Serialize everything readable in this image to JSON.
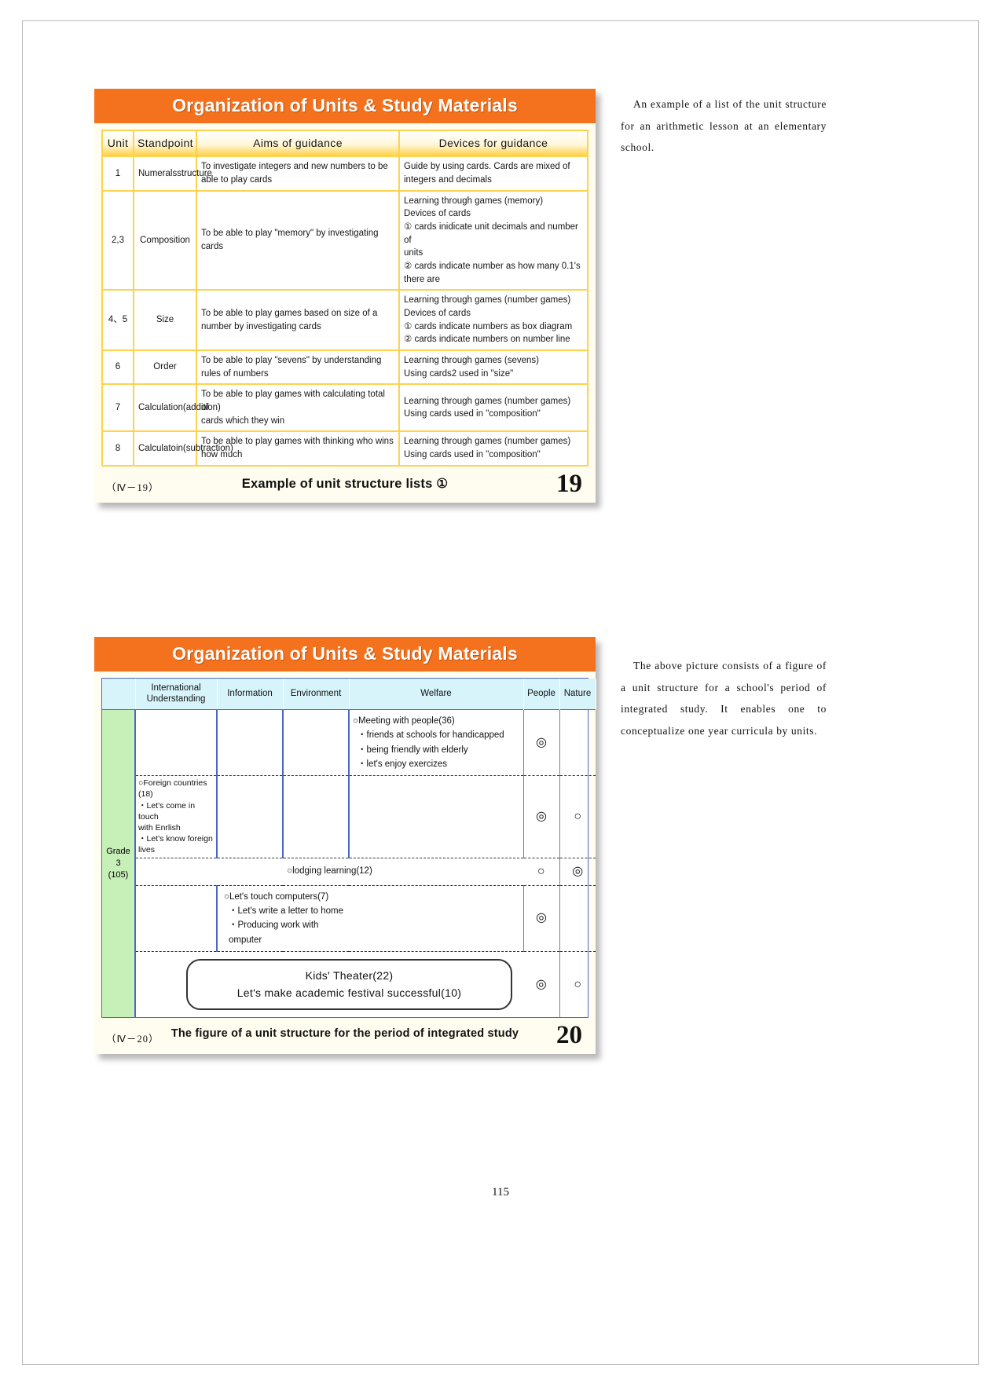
{
  "page": {
    "number": "115"
  },
  "slide1": {
    "title": "Organization of Units & Study Materials",
    "table": {
      "headers": [
        "Unit",
        "Standpoint",
        "Aims of guidance",
        "Devices for guidance"
      ],
      "rows": [
        {
          "unit": "1",
          "standpoint": [
            "Numerals",
            "structure"
          ],
          "aims": [
            "To investigate integers and new numbers to be",
            "able to play cards"
          ],
          "devices": [
            "Guide by using cards.  Cards are mixed of",
            "integers and decimals"
          ]
        },
        {
          "unit": "2,3",
          "standpoint": [
            "Composition"
          ],
          "aims": [
            "To be able to play \"memory\" by investigating",
            "cards"
          ],
          "devices": [
            "Learning through games (memory)",
            "Devices of cards",
            "① cards inidicate unit decimals and number of",
            "units",
            "② cards indicate number as how many 0.1's",
            "there are"
          ]
        },
        {
          "unit": "4、5",
          "standpoint": [
            "Size"
          ],
          "aims": [
            "To be able to play games based on size of a",
            "number by investigating cards"
          ],
          "devices": [
            "Learning through games (number games)",
            "Devices of cards",
            "① cards indicate numbers as box diagram",
            "② cards indicate numbers on number line"
          ]
        },
        {
          "unit": "6",
          "standpoint": [
            "Order"
          ],
          "aims": [
            "To be able to play \"sevens\" by understanding",
            "rules of numbers"
          ],
          "devices": [
            "Learning through games (sevens)",
            "Using cards2 used in \"size\""
          ]
        },
        {
          "unit": "7",
          "standpoint": [
            "Calculation",
            "(addition)"
          ],
          "aims": [
            "To be able to play games with calculating total of",
            "cards which they win"
          ],
          "devices": [
            "Learning through games (number games)",
            "Using cards used in \"composition\""
          ]
        },
        {
          "unit": "8",
          "standpoint": [
            "Calculatoin",
            "(subtraction)"
          ],
          "aims": [
            "To be able to play games with thinking who wins",
            "how much"
          ],
          "devices": [
            "Learning through games (number games)",
            "Using cards used in \"composition\""
          ]
        }
      ]
    },
    "footer": {
      "code": "（Ⅳ－19）",
      "caption": "Example of unit structure lists ①",
      "number": "19"
    },
    "note": "An example of a list of the unit structure for an arithmetic lesson at an elementary school."
  },
  "slide2": {
    "title": "Organization of Units & Study Materials",
    "grid": {
      "headers": {
        "blank": "",
        "international": [
          "International",
          "Understanding"
        ],
        "information": "Information",
        "environment": "Environment",
        "welfare": "Welfare",
        "people": "People",
        "nature": "Nature"
      },
      "grade": [
        "Grade",
        "3",
        "(105)"
      ],
      "rows": [
        {
          "welfare": [
            "○Meeting with people(36)",
            "・friends at schools for handicapped",
            "・being friendly with elderly",
            "・let's enjoy exercizes"
          ],
          "people": "◎",
          "nature": ""
        },
        {
          "international": [
            "○Foreign countries",
            "(18)",
            "・Let's come in touch",
            "with Enrlish",
            "・Let's know foreign",
            "lives"
          ],
          "people": "◎",
          "nature": "○"
        },
        {
          "span_text": "○lodging learning(12)",
          "people": "○",
          "nature": "◎"
        },
        {
          "information": [
            "○Let's touch computers(7)",
            "・Let's write a letter to home",
            "・Producing work with omputer"
          ],
          "people": "◎",
          "nature": ""
        },
        {
          "box": [
            "Kids' Theater(22)",
            "Let's make academic festival successful(10)"
          ],
          "people": "◎",
          "nature": "○"
        }
      ]
    },
    "footer": {
      "code": "（Ⅳ－20）",
      "caption": "The figure of a unit structure for the period of integrated study",
      "number": "20"
    },
    "note": "The above picture consists of a figure of a unit structure for a school's period of integrated study. It enables one to conceptualize one year curricula by units."
  }
}
